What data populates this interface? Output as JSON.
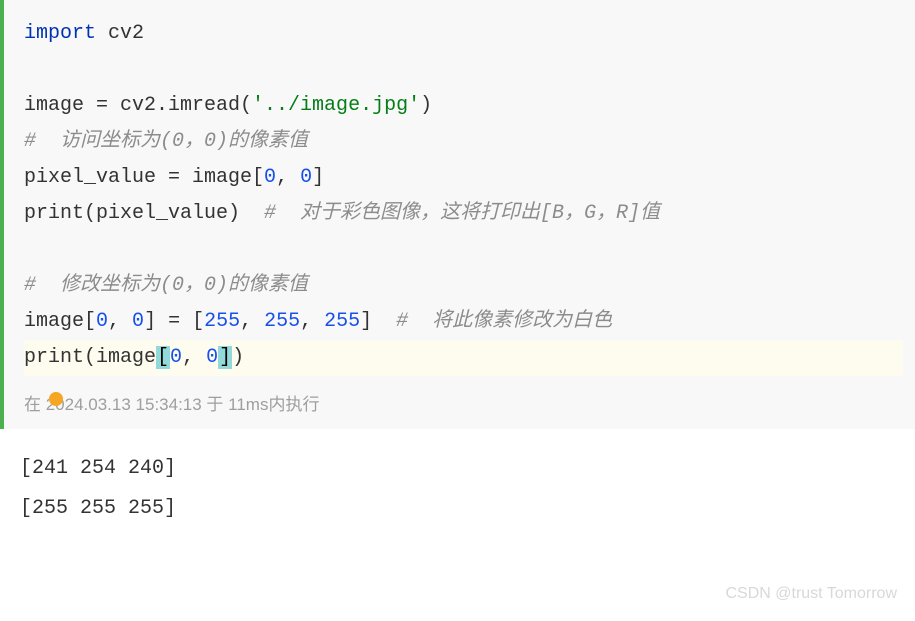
{
  "code": {
    "line1": {
      "keyword": "import",
      "module": " cv2"
    },
    "line3": {
      "var": "image = cv2.imread(",
      "string": "'../image.jpg'",
      "close": ")"
    },
    "line4": {
      "comment": "#  访问坐标为(0，0)的像素值"
    },
    "line5": {
      "text1": "pixel_value = image[",
      "num1": "0",
      "text2": ", ",
      "num2": "0",
      "text3": "]"
    },
    "line6": {
      "text": "print(pixel_value)  ",
      "comment": "#  对于彩色图像，这将打印出[B，G，R]值"
    },
    "line8": {
      "comment": "#  修改坐标为(0，0)的像素值"
    },
    "line9": {
      "text1": "image[",
      "num1": "0",
      "text2": ", ",
      "num2": "0",
      "text3": "] = [",
      "val1": "255",
      "text4": ", ",
      "val2": "255",
      "text5": ", ",
      "val3": "255",
      "text6": "]  ",
      "comment": "#  将此像素修改为白色"
    },
    "line10": {
      "text1": "print(image",
      "br1": "[",
      "num1": "0",
      "text2": ", ",
      "num2": "0",
      "br2": "]",
      "text3": ")"
    }
  },
  "status": "在 2024.03.13 15:34:13 于 11ms内执行",
  "output": {
    "line1": "[241 254 240]",
    "line2": "[255 255 255]"
  },
  "watermark": "CSDN @trust Tomorrow"
}
